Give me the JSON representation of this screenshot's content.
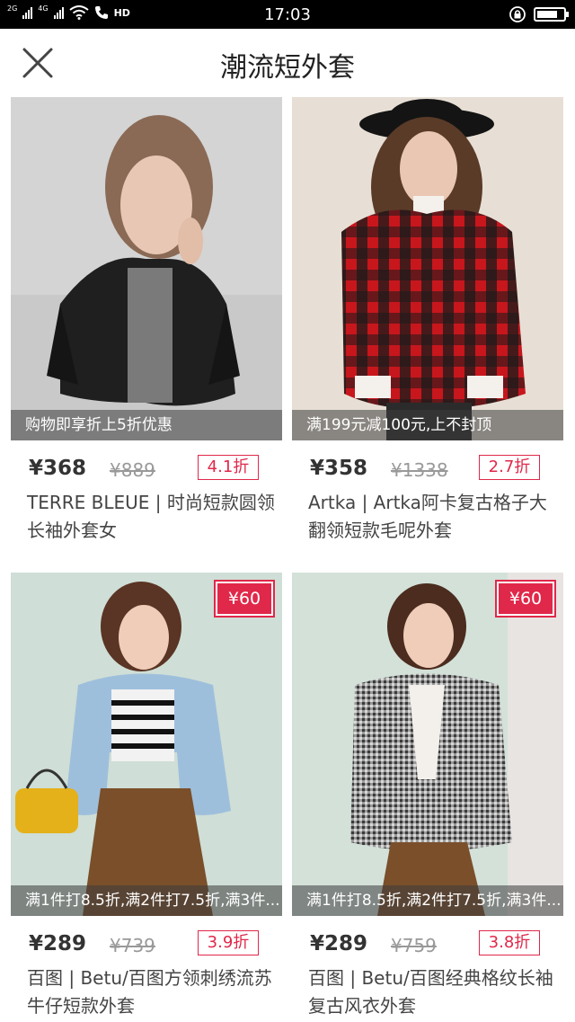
{
  "status_bar": {
    "net1": "2G",
    "net2": "4G",
    "hd": "HD",
    "time": "17:03"
  },
  "header": {
    "title": "潮流短外套"
  },
  "products": [
    {
      "promo": "购物即享折上5折优惠",
      "coupon": "",
      "price": "¥368",
      "old_price": "¥889",
      "discount": "4.1折",
      "name": "TERRE BLEUE | 时尚短款圆领长袖外套女"
    },
    {
      "promo": "满199元减100元,上不封顶",
      "coupon": "",
      "price": "¥358",
      "old_price": "¥1338",
      "discount": "2.7折",
      "name": "Artka | Artka阿卡复古格子大翻领短款毛呢外套"
    },
    {
      "promo": "满1件打8.5折,满2件打7.5折,满3件...",
      "coupon": "¥60",
      "price": "¥289",
      "old_price": "¥739",
      "discount": "3.9折",
      "name": "百图 | Betu/百图方领刺绣流苏牛仔短款外套"
    },
    {
      "promo": "满1件打8.5折,满2件打7.5折,满3件...",
      "coupon": "¥60",
      "price": "¥289",
      "old_price": "¥759",
      "discount": "3.8折",
      "name": "百图 | Betu/百图经典格纹长袖复古风衣外套"
    }
  ],
  "colors": {
    "accent": "#e0284a",
    "status_bar": "#000000"
  },
  "icons": [
    "close-icon",
    "wifi-icon",
    "phone-icon",
    "lock-rotation-icon",
    "battery-icon"
  ]
}
